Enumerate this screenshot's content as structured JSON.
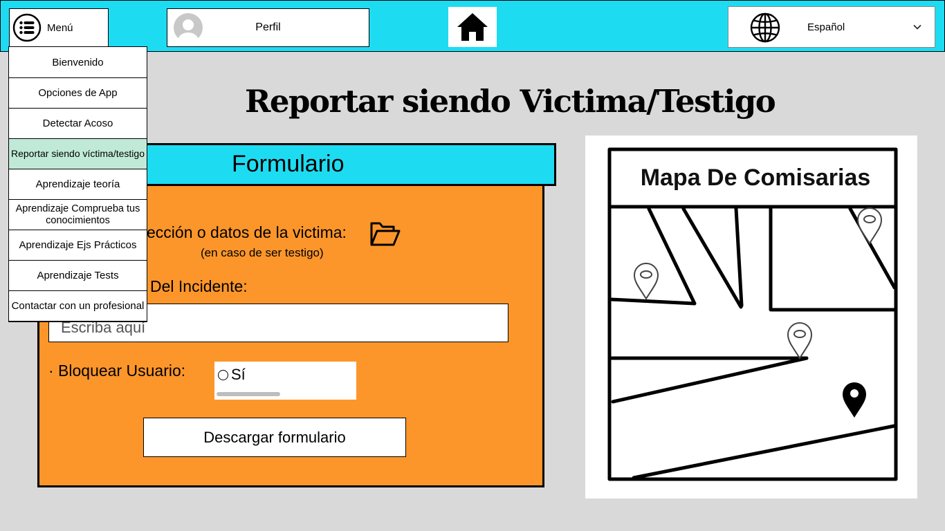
{
  "topbar": {
    "menu_label": "Menú",
    "profile_label": "Perfil",
    "language": "Español",
    "accent_color": "#1ddcf2"
  },
  "menu": {
    "items": [
      {
        "label": "Bienvenido"
      },
      {
        "label": "Opciones de App"
      },
      {
        "label": "Detectar Acoso"
      },
      {
        "label": "Reportar siendo víctima/testigo",
        "active": true
      },
      {
        "label": "Aprendizaje teoría"
      },
      {
        "label": "Aprendizaje Comprueba tus conocimientos"
      },
      {
        "label": "Aprendizaje Ejs Prácticos"
      },
      {
        "label": "Aprendizaje Tests"
      },
      {
        "label": "Contactar con un profesional"
      }
    ],
    "active_color": "#c0ead7"
  },
  "page": {
    "title": "Reportar siendo Victima/Testigo"
  },
  "form": {
    "header": "Formulario",
    "panel_color": "#fc962b",
    "direction_label": "ección o datos de la victima:",
    "direction_note": "(en caso de ser testigo)",
    "incident_label": "Del Incidente:",
    "incident_placeholder": "Escriba aquí",
    "block_label": "· Bloquear Usuario:",
    "block_option": "Sí",
    "download_button": "Descargar formulario"
  },
  "map": {
    "title": "Mapa De Comisarias"
  },
  "icons": {
    "menu": "list-icon",
    "avatar": "user-avatar-icon",
    "home": "home-icon",
    "language": "globe-icon",
    "dropdown": "chevron-down-icon",
    "attach": "folder-icon",
    "marker": "map-pin-icon"
  }
}
